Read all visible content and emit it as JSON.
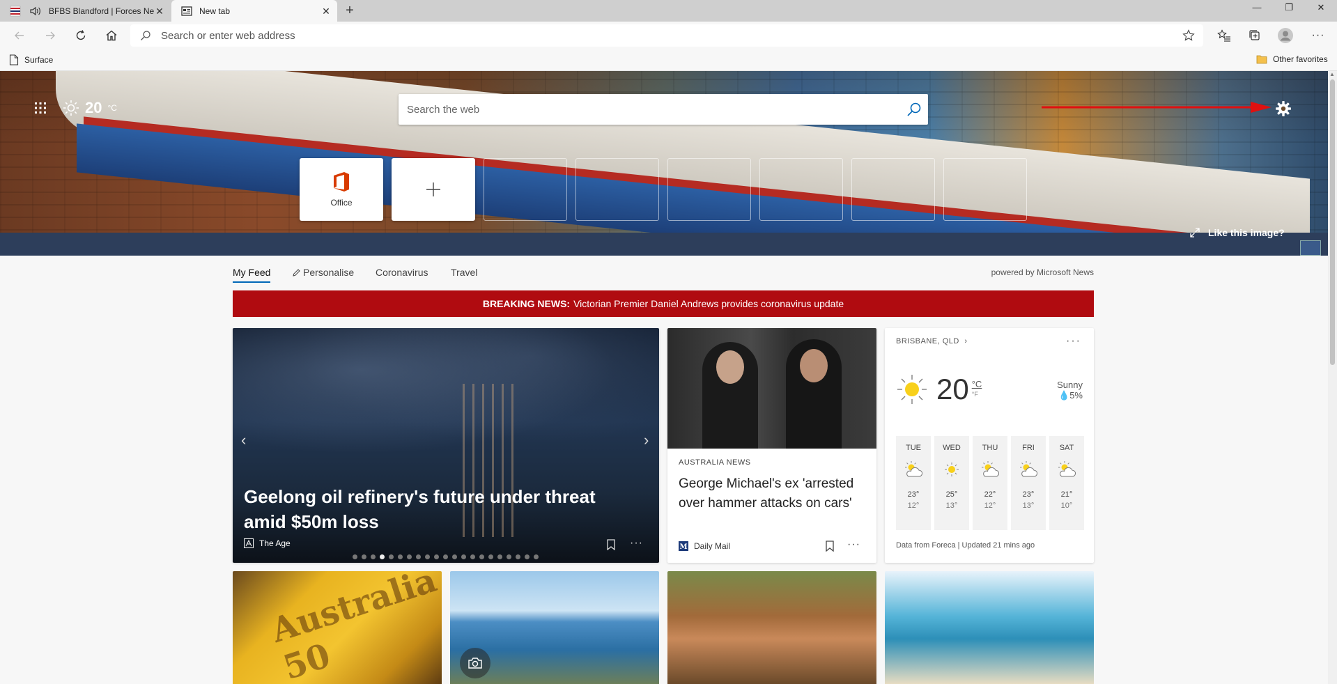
{
  "tabs": [
    {
      "title": "BFBS Blandford | Forces News",
      "active": false,
      "audio": true
    },
    {
      "title": "New tab",
      "active": true,
      "audio": false
    }
  ],
  "address_bar": {
    "placeholder": "Search or enter web address"
  },
  "favorites_bar": {
    "items": [
      "Surface"
    ],
    "other": "Other favorites"
  },
  "hero": {
    "temperature": "20",
    "temp_unit": "°C",
    "search_placeholder": "Search the web",
    "quick_links": [
      {
        "label": "Office"
      }
    ],
    "like_image": "Like this image?"
  },
  "feed_nav": {
    "tabs": [
      "My Feed",
      "Personalise",
      "Coronavirus",
      "Travel"
    ],
    "powered_by": "powered by Microsoft News"
  },
  "breaking": {
    "label": "BREAKING NEWS:",
    "text": "Victorian Premier Daniel Andrews provides coronavirus update"
  },
  "hero_story": {
    "headline": "Geelong oil refinery's future under threat amid $50m loss",
    "source": "The Age",
    "slide_count": 21,
    "active_slide": 3
  },
  "story2": {
    "category": "AUSTRALIA NEWS",
    "headline": "George Michael's ex 'arrested over hammer attacks on cars'",
    "source": "Daily Mail"
  },
  "weather": {
    "location": "BRISBANE, QLD",
    "temp": "20",
    "unit_c": "°C",
    "unit_f": "°F",
    "condition": "Sunny",
    "precip": "5%",
    "forecast": [
      {
        "day": "TUE",
        "hi": "23°",
        "lo": "12°",
        "icon": "partly-cloudy"
      },
      {
        "day": "WED",
        "hi": "25°",
        "lo": "13°",
        "icon": "sunny"
      },
      {
        "day": "THU",
        "hi": "22°",
        "lo": "12°",
        "icon": "partly-cloudy"
      },
      {
        "day": "FRI",
        "hi": "23°",
        "lo": "13°",
        "icon": "partly-cloudy"
      },
      {
        "day": "SAT",
        "hi": "21°",
        "lo": "10°",
        "icon": "partly-cloudy"
      }
    ],
    "footer": "Data from Foreca | Updated 21 mins ago"
  },
  "thumbnails": {
    "tile1_text": "Australia 50"
  },
  "colors": {
    "accent": "#0067b8",
    "breaking": "#b00b10",
    "annotation_arrow": "#e01010"
  }
}
